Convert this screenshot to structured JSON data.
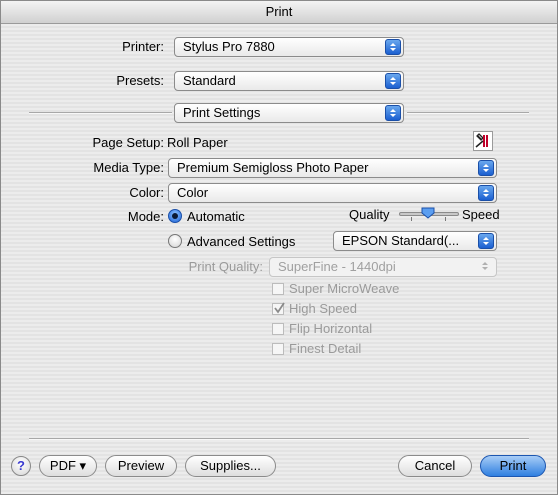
{
  "window": {
    "title": "Print"
  },
  "printer": {
    "label": "Printer:",
    "value": "Stylus Pro 7880"
  },
  "presets": {
    "label": "Presets:",
    "value": "Standard"
  },
  "panel": {
    "value": "Print Settings"
  },
  "page_setup": {
    "label": "Page Setup:",
    "value": "Roll Paper"
  },
  "media_type": {
    "label": "Media Type:",
    "value": "Premium Semigloss Photo Paper"
  },
  "color": {
    "label": "Color:",
    "value": "Color"
  },
  "mode": {
    "label": "Mode:",
    "automatic_label": "Automatic",
    "advanced_label": "Advanced Settings",
    "selected": "Automatic",
    "quality_label": "Quality",
    "speed_label": "Speed",
    "slider_level": 0.4,
    "advanced_preset": "EPSON Standard(..."
  },
  "print_quality": {
    "label": "Print Quality:",
    "value": "SuperFine - 1440dpi"
  },
  "options": [
    {
      "label": "Super MicroWeave",
      "checked": false
    },
    {
      "label": "High Speed",
      "checked": true
    },
    {
      "label": "Flip Horizontal",
      "checked": false
    },
    {
      "label": "Finest Detail",
      "checked": false
    }
  ],
  "buttons": {
    "help": "?",
    "pdf": "PDF ▾",
    "preview": "Preview",
    "supplies": "Supplies...",
    "cancel": "Cancel",
    "print": "Print"
  },
  "colors": {
    "accent": "#2f7fe0"
  }
}
